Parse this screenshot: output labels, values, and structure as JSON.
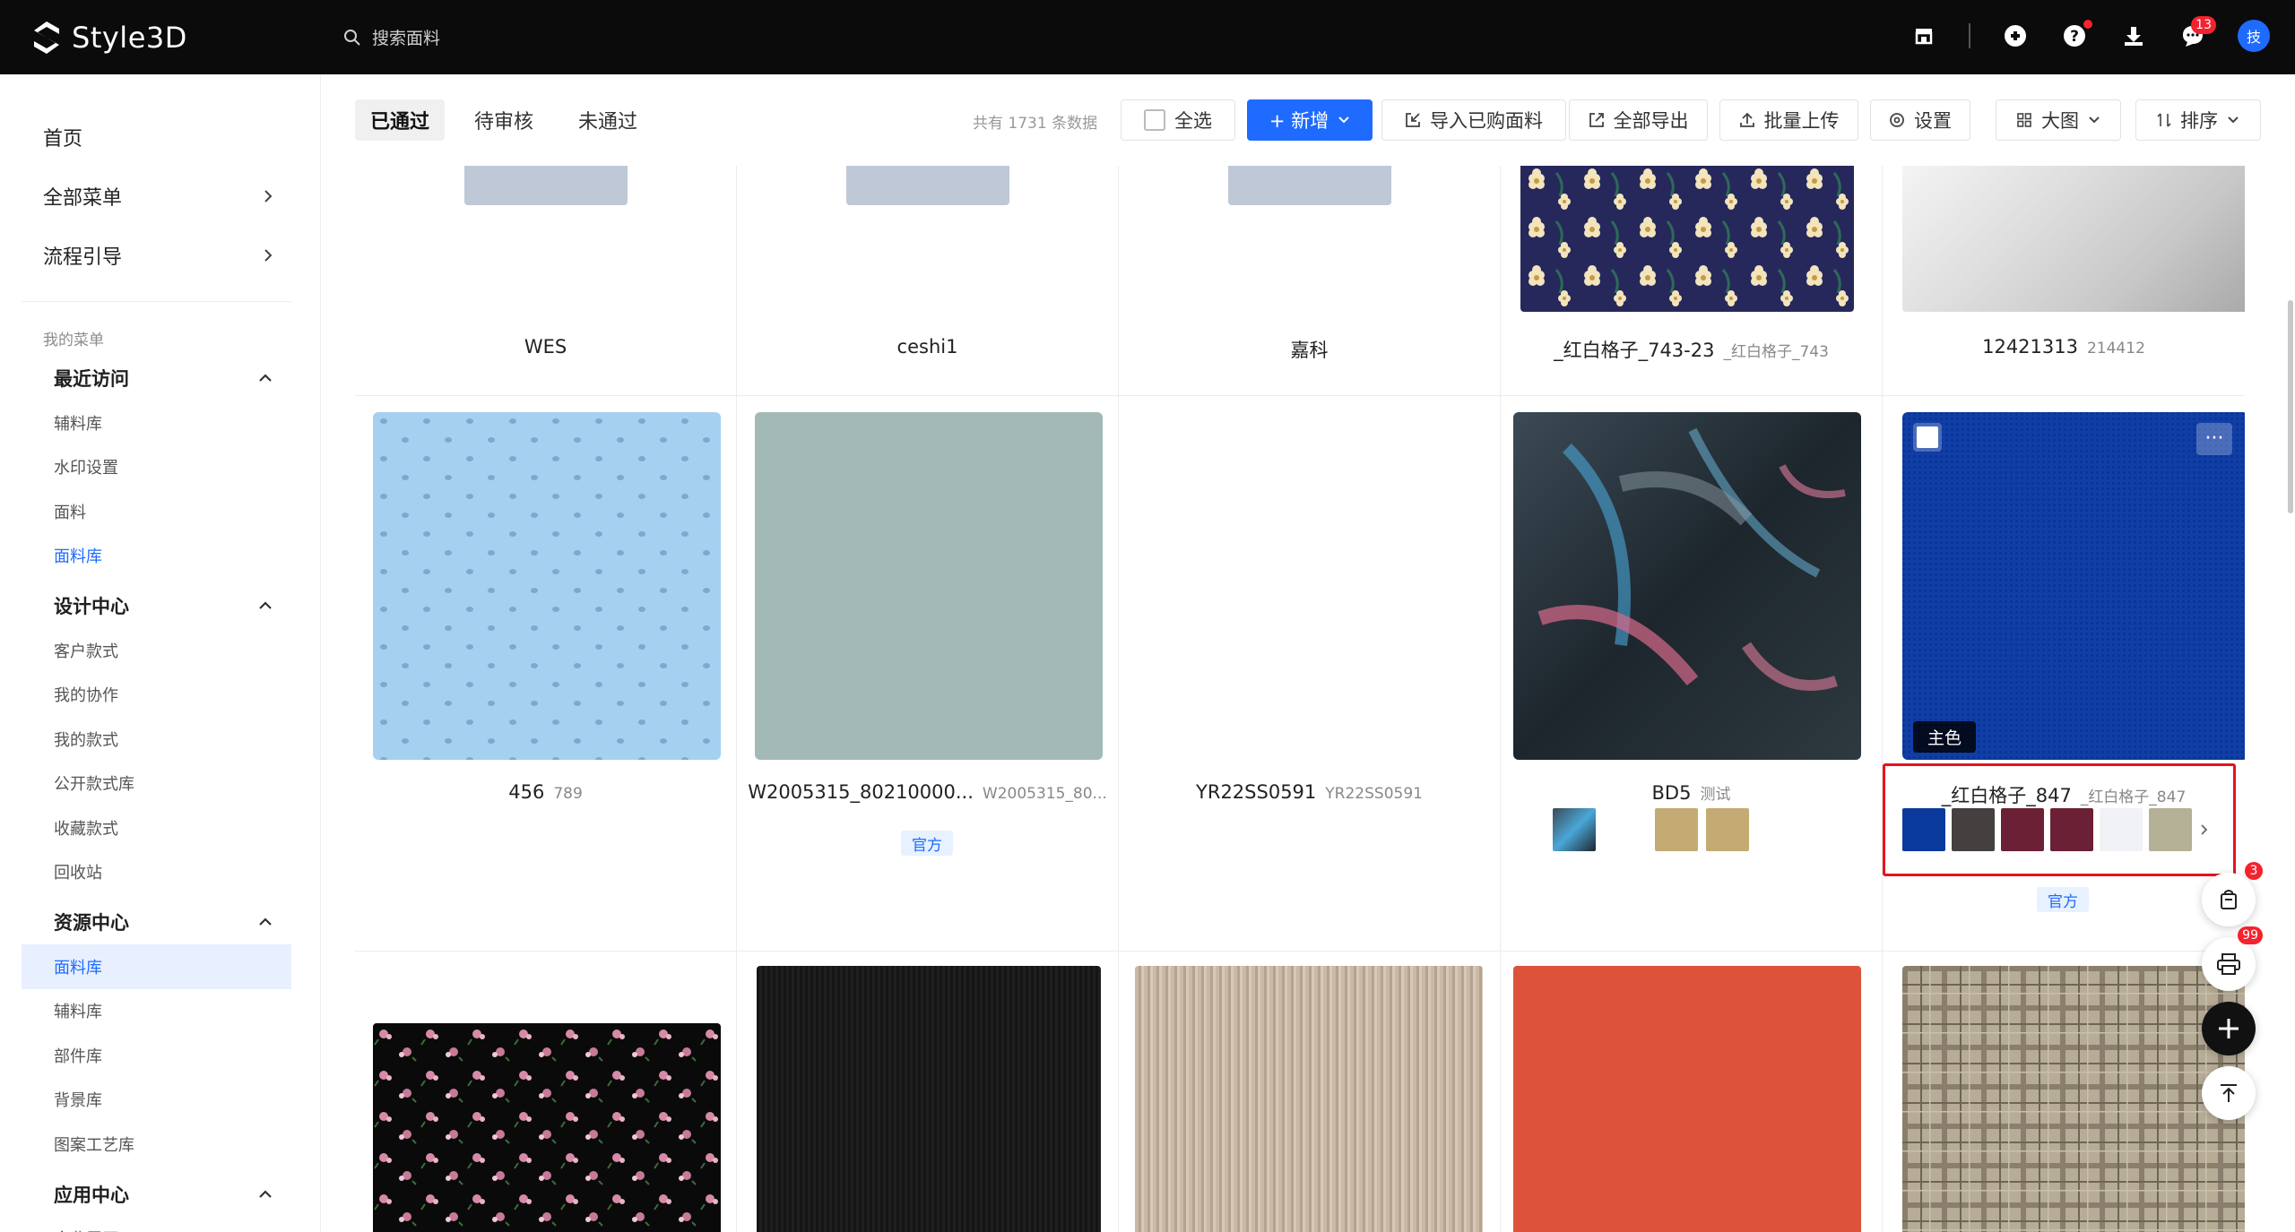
{
  "app": {
    "name": "Style3D"
  },
  "search": {
    "placeholder": "搜索面料"
  },
  "header": {
    "message_count": "13",
    "avatar_text": "技",
    "brand_color": "#1f6bff"
  },
  "sidebar": {
    "top_items": [
      {
        "label": "首页",
        "has_arrow": false
      },
      {
        "label": "全部菜单",
        "has_arrow": true
      },
      {
        "label": "流程引导",
        "has_arrow": true
      }
    ],
    "my_menu_caption": "我的菜单",
    "groups": [
      {
        "title": "最近访问",
        "items": [
          "辅料库",
          "水印设置",
          "面料",
          "面料库"
        ]
      },
      {
        "title": "设计中心",
        "items": [
          "客户款式",
          "我的协作",
          "我的款式",
          "公开款式库",
          "收藏款式",
          "回收站"
        ]
      },
      {
        "title": "资源中心",
        "items": [
          "面料库",
          "辅料库",
          "部件库",
          "背景库",
          "图案工艺库"
        ]
      },
      {
        "title": "应用中心",
        "items": [
          "企业展厅"
        ]
      }
    ]
  },
  "toolbar": {
    "tabs": [
      "已通过",
      "待审核",
      "未通过"
    ],
    "count_text": "共有 1731 条数据",
    "select_all": "全选",
    "add": "+ 新增",
    "import": "导入已购面料",
    "export": "全部导出",
    "upload": "批量上传",
    "settings": "设置",
    "view": "大图",
    "sort": "排序"
  },
  "fabrics_row1": [
    {
      "name": "WES",
      "sub": ""
    },
    {
      "name": "ceshi1",
      "sub": ""
    },
    {
      "name": "嘉科",
      "sub": ""
    },
    {
      "name": "_红白格子_743-23",
      "sub": "_红白格子_743"
    },
    {
      "name": "12421313",
      "sub": "214412"
    }
  ],
  "fabrics_row2": [
    {
      "name": "456",
      "sub": "789",
      "tag": ""
    },
    {
      "name": "W2005315_80210000...",
      "sub": "W2005315_80...",
      "tag": "官方"
    },
    {
      "name": "YR22SS0591",
      "sub": "YR22SS0591",
      "tag": ""
    },
    {
      "name": "BD5",
      "sub": "测试",
      "tag": ""
    },
    {
      "name": "_红白格子_847",
      "sub": "_红白格子_847",
      "tag": "官方",
      "main_color_label": "主色"
    }
  ],
  "colorways": {
    "bd5": [
      "#c3ab73",
      "#c3ab73"
    ],
    "card847": [
      "#0a3a9b",
      "#454040",
      "#6b2035",
      "#6b2035",
      "#f0f2f6",
      "#b5b197"
    ]
  },
  "floating": {
    "bag_count": "3",
    "print_count": "99"
  }
}
